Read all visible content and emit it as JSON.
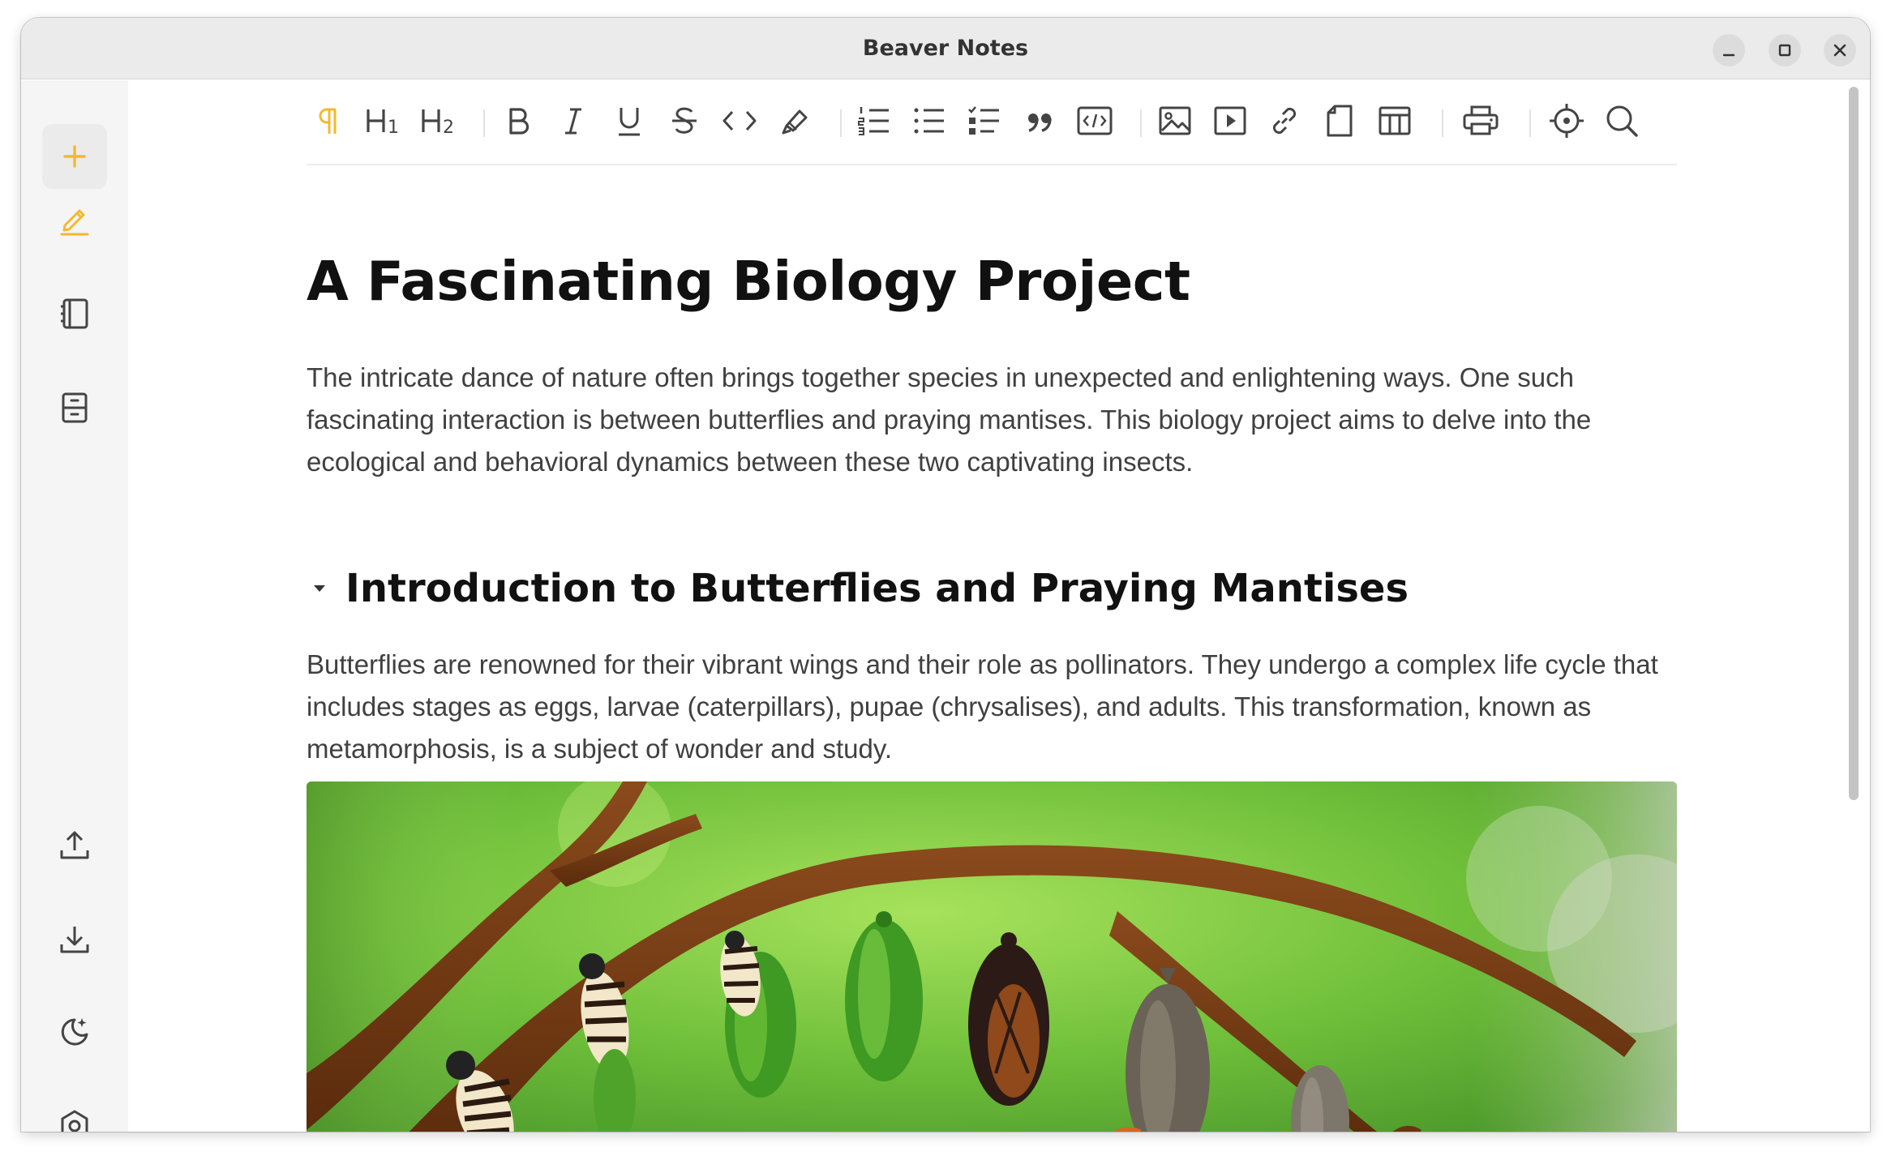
{
  "window": {
    "title": "Beaver Notes",
    "controls": [
      "minimize",
      "maximize",
      "close"
    ]
  },
  "sidebar": {
    "top_items": [
      {
        "name": "new-note",
        "icon": "plus-icon",
        "color": "#f5b82e"
      },
      {
        "name": "editor",
        "icon": "pencil-icon",
        "color": "#f5b82e",
        "active": true
      },
      {
        "name": "notebook",
        "icon": "notebook-icon"
      },
      {
        "name": "archive",
        "icon": "archive-icon"
      }
    ],
    "bottom_items": [
      {
        "name": "export",
        "icon": "upload-icon"
      },
      {
        "name": "import",
        "icon": "download-icon"
      },
      {
        "name": "dark-mode",
        "icon": "moon-stars-icon"
      },
      {
        "name": "settings",
        "icon": "settings-icon"
      }
    ]
  },
  "toolbar": {
    "groups": [
      [
        "paragraph",
        "heading-1",
        "heading-2"
      ],
      [
        "bold",
        "italic",
        "underline",
        "strikethrough",
        "code",
        "highlight"
      ],
      [
        "ordered-list",
        "bullet-list",
        "task-list",
        "blockquote",
        "code-block"
      ],
      [
        "image",
        "video",
        "link",
        "file",
        "table"
      ],
      [
        "print"
      ],
      [
        "focus",
        "search"
      ]
    ],
    "h1_label": "H1",
    "h2_label": "H2",
    "accent": "#f5b82e"
  },
  "document": {
    "title": "A Fascinating Biology Project",
    "intro": "The intricate dance of nature often brings together species in unexpected and enlightening ways. One such fascinating interaction is between butterflies and praying mantises. This biology project aims to delve into the ecological and behavioral dynamics between these two captivating insects.",
    "section_heading": "Introduction to Butterflies and Praying Mantises",
    "section_body": "Butterflies are renowned for their vibrant wings and their role as pollinators. They undergo a complex life cycle that includes stages as eggs, larvae (caterpillars), pupae (chrysalises), and adults. This transformation, known as metamorphosis, is a subject of wonder and study.",
    "image_subject": "butterfly life cycle illustration on a branch"
  }
}
